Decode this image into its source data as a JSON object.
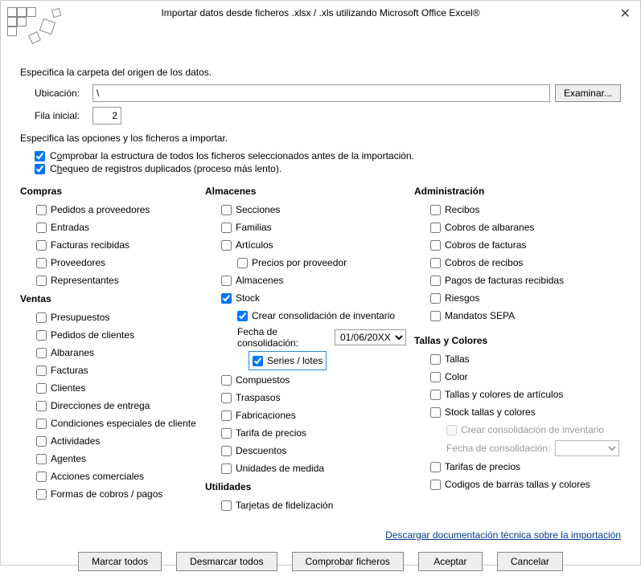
{
  "title": "Importar datos desde ficheros .xlsx / .xls utilizando Microsoft Office Excel®",
  "section1": "Especifica la carpeta del origen de los datos.",
  "ubicacion_label": "Ubicación:",
  "ubicacion_value": "\\",
  "browse": "Examinar...",
  "fila_label": "Fila inicial:",
  "fila_value": "2",
  "section2": "Especifica las opciones y los ficheros a importar.",
  "opt_check_struct_pre": "C",
  "opt_check_struct_u": "o",
  "opt_check_struct_post": "mprobar la estructura de todos los ficheros seleccionados antes de la importación.",
  "opt_dup_pre": "C",
  "opt_dup_u": "h",
  "opt_dup_post": "equeo de registros duplicados (proceso más lento).",
  "groups": {
    "compras": "Compras",
    "ventas": "Ventas",
    "almacenes": "Almacenes",
    "utilidades": "Utilidades",
    "admin": "Administración",
    "tallas": "Tallas y Colores"
  },
  "compras": {
    "pedidos_prov": "Pedidos a proveedores",
    "entradas": "Entradas",
    "facturas_rec": "Facturas recibidas",
    "proveedores": "Proveedores",
    "representantes": "Representantes"
  },
  "ventas": {
    "presupuestos": "Presupuestos",
    "pedidos_cli": "Pedidos de clientes",
    "albaranes": "Albaranes",
    "facturas": "Facturas",
    "clientes": "Clientes",
    "direcciones": "Direcciones de entrega",
    "condiciones": "Condiciones especiales de cliente",
    "actividades": "Actividades",
    "agentes": "Agentes",
    "acciones": "Acciones comerciales",
    "formas_cobros": "Formas de cobros / pagos"
  },
  "almacenes": {
    "secciones": "Secciones",
    "familias": "Familias",
    "articulos": "Artículos",
    "precios_prov": "Precios por proveedor",
    "almacenes": "Almacenes",
    "stock": "Stock",
    "crear_consol": "Crear consolidación de inventario",
    "fecha_consol": "Fecha de consolidación:",
    "fecha_val": "01/06/20XX",
    "series_lotes": "Series / lotes",
    "compuestos": "Compuestos",
    "traspasos": "Traspasos",
    "fabricaciones": "Fabricaciones",
    "tarifa": "Tarifa de precios",
    "descuentos": "Descuentos",
    "unidades": "Unidades de medida"
  },
  "utilidades": {
    "tarjetas": "Tarjetas de fidelización"
  },
  "admin": {
    "recibos": "Recibos",
    "cobros_alb": "Cobros de albaranes",
    "cobros_fact": "Cobros de facturas",
    "cobros_rec": "Cobros de recibos",
    "pagos_fact": "Pagos de facturas recibidas",
    "riesgos": "Riesgos",
    "mandatos": "Mandatos SEPA"
  },
  "tallas": {
    "tallas": "Tallas",
    "color": "Color",
    "tallas_colores_art": "Tallas y colores de artículos",
    "stock_tc": "Stock tallas y colores",
    "crear_consol": "Crear consolidación de inventario",
    "fecha_consol": "Fecha de consolidación:",
    "tarifas": "Tarifas de precios",
    "codigos": "Codigos de barras tallas y colores"
  },
  "link": "Descargar documentación técnica sobre la importación",
  "buttons": {
    "marcar": "Marcar todos",
    "desmarcar": "Desmarcar todos",
    "comprobar": "Comprobar ficheros",
    "aceptar": "Aceptar",
    "cancelar": "Cancelar"
  }
}
